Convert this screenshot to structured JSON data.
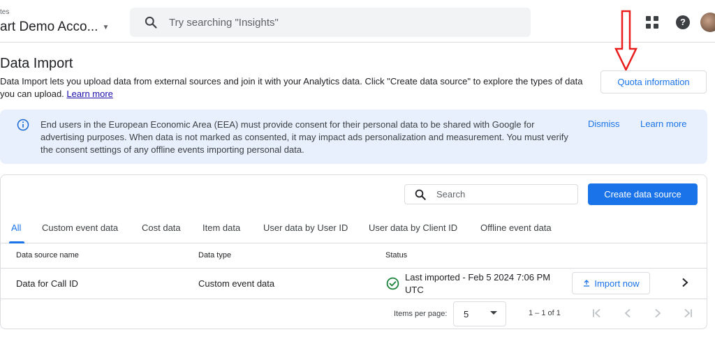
{
  "header": {
    "account_small": "tes",
    "account_name": "art Demo Acco...",
    "search_placeholder": "Try searching \"Insights\""
  },
  "page": {
    "title": "Data Import",
    "description": "Data Import lets you upload data from external sources and join it with your Analytics data. Click \"Create data source\" to explore the types of data you can upload.",
    "learn_more": "Learn more",
    "quota_button": "Quota information"
  },
  "banner": {
    "text": "End users in the European Economic Area (EEA) must provide consent for their personal data to be shared with Google for advertising purposes. When data is not marked as consented, it may impact ads personalization and measurement. You must verify the consent settings of any offline events importing personal data.",
    "dismiss": "Dismiss",
    "learn_more": "Learn more"
  },
  "toolbar": {
    "search_placeholder": "Search",
    "create_button": "Create data source"
  },
  "tabs": [
    {
      "label": "All"
    },
    {
      "label": "Custom event data"
    },
    {
      "label": "Cost data"
    },
    {
      "label": "Item data"
    },
    {
      "label": "User data by User ID"
    },
    {
      "label": "User data by Client ID"
    },
    {
      "label": "Offline event data"
    }
  ],
  "table": {
    "columns": [
      "Data source name",
      "Data type",
      "Status"
    ],
    "rows": [
      {
        "name": "Data for Call ID",
        "type": "Custom event data",
        "status_line1": "Last imported - Feb 5 2024 7:06 PM",
        "status_line2": "UTC",
        "action": "Import now"
      }
    ]
  },
  "pagination": {
    "items_per_page_label": "Items per page:",
    "items_per_page": "5",
    "range": "1 – 1 of 1"
  },
  "colors": {
    "accent": "#1a73e8",
    "banner_bg": "#e8f0fe",
    "status_ok": "#188038",
    "annotation": "#ea1d1d"
  }
}
